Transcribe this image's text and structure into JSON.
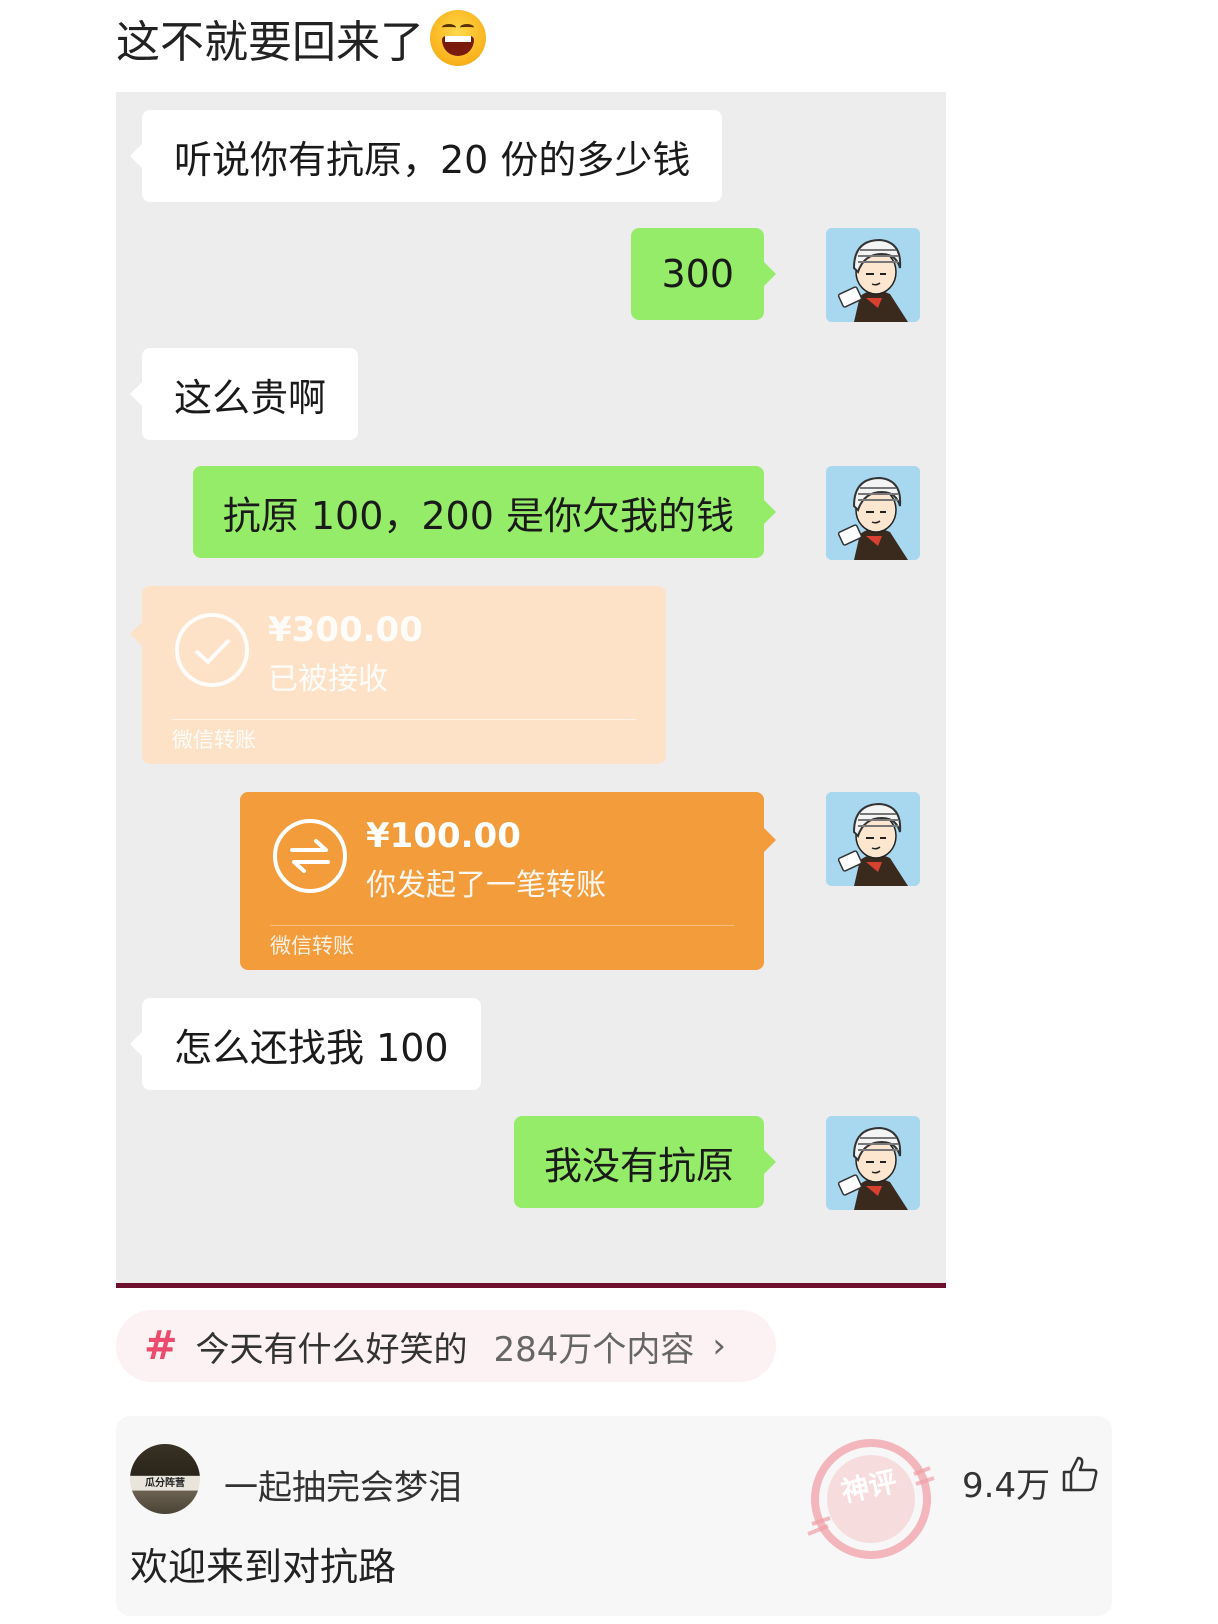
{
  "post": {
    "caption": "这不就要回来了",
    "caption_emoji": "laughing-face-icon"
  },
  "chat": {
    "messages": [
      {
        "side": "in",
        "text": "听说你有抗原，20 份的多少钱"
      },
      {
        "side": "out",
        "text": "300"
      },
      {
        "side": "in",
        "text": "这么贵啊"
      },
      {
        "side": "out",
        "text": "抗原 100，200 是你欠我的钱"
      },
      {
        "side": "out",
        "text": "我没有抗原"
      },
      {
        "side": "in",
        "text": "怎么还找我 100"
      }
    ],
    "transfer_received": {
      "amount": "¥300.00",
      "status": "已被接收",
      "footer": "微信转账"
    },
    "transfer_sent": {
      "amount": "¥100.00",
      "status": "你发起了一笔转账",
      "footer": "微信转账"
    },
    "colors": {
      "background": "#ededed",
      "out_bubble": "#95ec69",
      "in_bubble": "#ffffff",
      "transfer_sent": "#f39c3c",
      "transfer_received": "#fde2c8"
    }
  },
  "topic": {
    "icon": "hashtag-icon",
    "name": "今天有什么好笑的",
    "count": "284万个内容",
    "arrow": "›"
  },
  "comment": {
    "username": "一起抽完会梦泪",
    "text": "欢迎来到对抗路",
    "likes": "9.4万",
    "avatar_sign": "瓜分阵营"
  },
  "watermark": {
    "text": "神评",
    "icon": "shenping-stamp-icon"
  }
}
